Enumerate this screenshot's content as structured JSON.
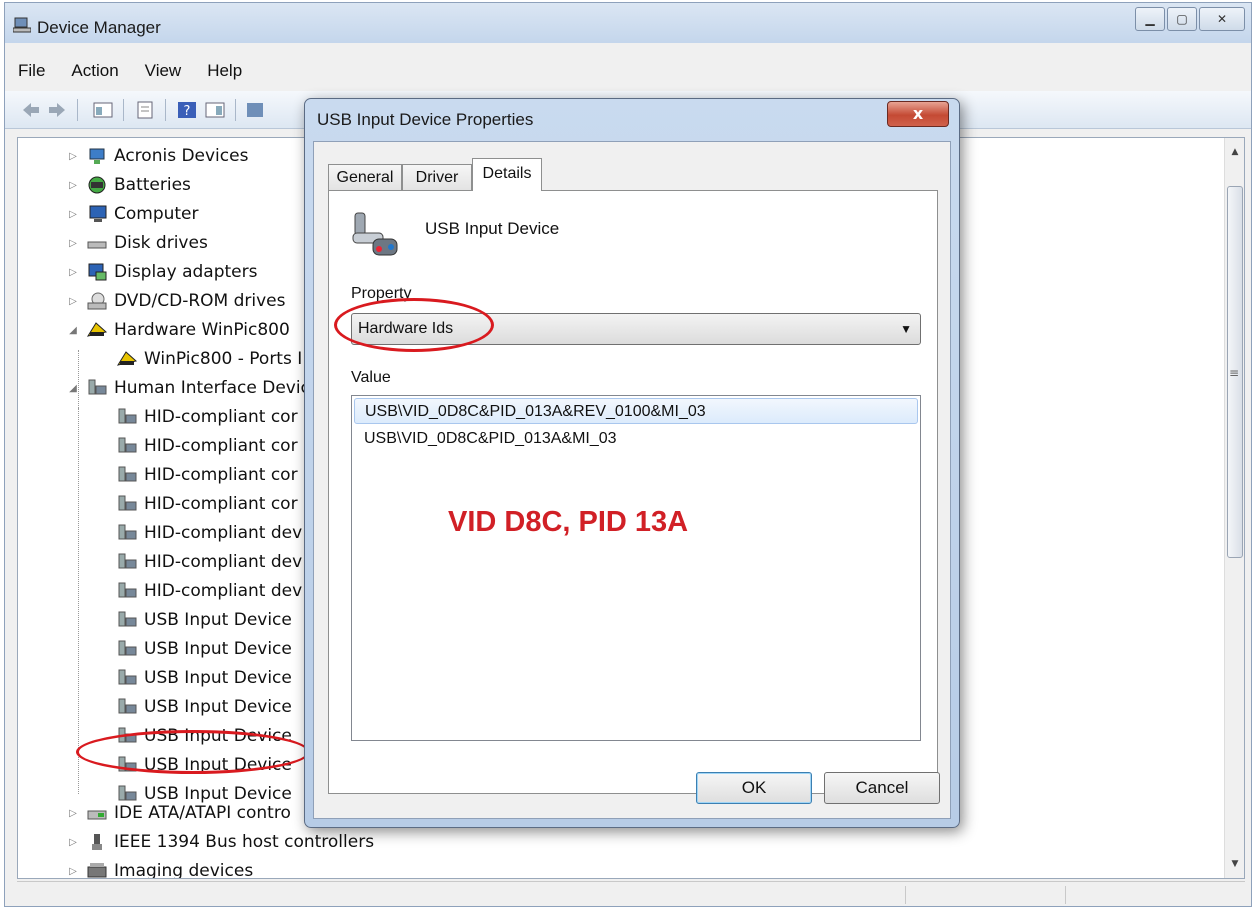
{
  "window": {
    "title": "Device Manager"
  },
  "menu": [
    "File",
    "Action",
    "View",
    "Help"
  ],
  "tree": {
    "items": [
      {
        "label": "Acronis Devices",
        "icon": "network-icon"
      },
      {
        "label": "Batteries",
        "icon": "battery-icon"
      },
      {
        "label": "Computer",
        "icon": "computer-icon"
      },
      {
        "label": "Disk drives",
        "icon": "disk-icon"
      },
      {
        "label": "Display adapters",
        "icon": "display-icon"
      },
      {
        "label": "DVD/CD-ROM drives",
        "icon": "dvd-icon"
      },
      {
        "label": "Hardware WinPic800",
        "icon": "hardware-icon"
      },
      {
        "label": "WinPic800 - Ports I",
        "icon": "hardware-icon"
      },
      {
        "label": "Human Interface Devic",
        "icon": "hid-icon"
      },
      {
        "label": "HID-compliant cor",
        "icon": "hid-icon"
      },
      {
        "label": "HID-compliant cor",
        "icon": "hid-icon"
      },
      {
        "label": "HID-compliant cor",
        "icon": "hid-icon"
      },
      {
        "label": "HID-compliant cor",
        "icon": "hid-icon"
      },
      {
        "label": "HID-compliant dev",
        "icon": "hid-icon"
      },
      {
        "label": "HID-compliant dev",
        "icon": "hid-icon"
      },
      {
        "label": "HID-compliant dev",
        "icon": "hid-icon"
      },
      {
        "label": "USB Input Device",
        "icon": "hid-icon"
      },
      {
        "label": "USB Input Device",
        "icon": "hid-icon"
      },
      {
        "label": "USB Input Device",
        "icon": "hid-icon"
      },
      {
        "label": "USB Input Device",
        "icon": "hid-icon"
      },
      {
        "label": "USB Input Device",
        "icon": "hid-icon"
      },
      {
        "label": "USB Input Device",
        "icon": "hid-icon"
      },
      {
        "label": "USB Input Device",
        "icon": "hid-icon"
      },
      {
        "label": "IDE ATA/ATAPI contro",
        "icon": "ide-icon"
      },
      {
        "label": "IEEE 1394 Bus host controllers",
        "icon": "firewire-icon"
      },
      {
        "label": "Imaging devices",
        "icon": "imaging-icon"
      }
    ]
  },
  "dialog": {
    "title": "USB Input Device Properties",
    "close": "x",
    "tabs": [
      "General",
      "Driver",
      "Details"
    ],
    "device_name": "USB Input Device",
    "property_label": "Property",
    "property_value": "Hardware Ids",
    "value_label": "Value",
    "values": [
      "USB\\VID_0D8C&PID_013A&REV_0100&MI_03",
      "USB\\VID_0D8C&PID_013A&MI_03"
    ],
    "annotation": "VID D8C, PID 13A",
    "ok": "OK",
    "cancel": "Cancel"
  },
  "colors": {
    "annotation_red": "#d12026",
    "title_bar": "#c4d6ec"
  }
}
